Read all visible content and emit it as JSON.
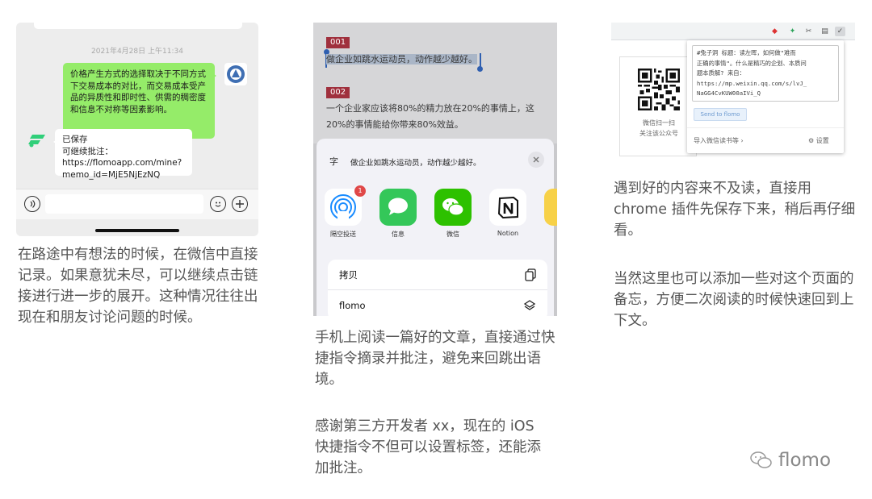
{
  "wechat": {
    "timestamp": "2021年4月28日 上午11:34",
    "sent_message": "价格产生方式的选择取决于不同方式下交易成本的对比，而交易成本受产品的异质性和即时性、供需的稠密度和信息不对称等因素影响。",
    "reply_line1": "已保存",
    "reply_line2": "可继续批注：https://flomoapp.com/mine?memo_id=MjE5NjEzNQ",
    "voice_icon": "voice-icon",
    "emoji_icon": "emoji-icon",
    "plus_icon": "plus-icon"
  },
  "ios": {
    "tag1": "001",
    "line1": "做企业如跳水运动员，动作越少越好。",
    "tag2": "002",
    "line2a": "一个企业家应该将80%的精力放在20%的事情上，这",
    "line2b": "20%的事情能给你带来80%效益。",
    "sheet_icon": "字",
    "sheet_title": "做企业如跳水运动员，动作越少越好。",
    "apps": [
      {
        "label": "隔空投送",
        "badge": "1"
      },
      {
        "label": "信息"
      },
      {
        "label": "微信"
      },
      {
        "label": "Notion"
      }
    ],
    "actions": [
      {
        "label": "拷贝",
        "icon": "copy-icon"
      },
      {
        "label": "flomo",
        "icon": "layers-icon"
      }
    ]
  },
  "chrome": {
    "memo_line1": "#兔子洞  标题：读左晖，如何做\"难而",
    "memo_line2": "正确的事情\"。什么是精巧的企划、本质问",
    "memo_line3": "题本质解? 来自：",
    "memo_line4": "https://mp.weixin.qq.com/s/lvJ_",
    "memo_line5": "NaGG4CvKUW00aIVi_Q",
    "send_label": "Send to flomo",
    "import_label": "导入微信读书等 ›",
    "settings_label": "⚙ 设置",
    "qr_text1": "微信扫一扫",
    "qr_text2": "关注该公众号"
  },
  "captions": {
    "left": "在路途中有想法的时候，在微信中直接记录。如果意犹未尽，可以继续点击链接进行进一步的展开。这种情况往往出现在和朋友讨论问题的时候。",
    "mid1": "手机上阅读一篇好的文章，直接通过快捷指令摘录并批注，避免来回跳出语境。",
    "mid2": "感谢第三方开发者 xx，现在的 iOS 快捷指令不但可以设置标签，还能添加批注。",
    "right1": "遇到好的内容来不及读，直接用 chrome 插件先保存下来，稍后再仔细看。",
    "right2": "当然这里也可以添加一些对这个页面的备忘，方便二次阅读的时候快速回到上下文。"
  },
  "watermark": "flomo",
  "colors": {
    "wechat_green": "#95ec69",
    "flomo_green": "#30cf79",
    "tag_red": "#a0303d"
  }
}
